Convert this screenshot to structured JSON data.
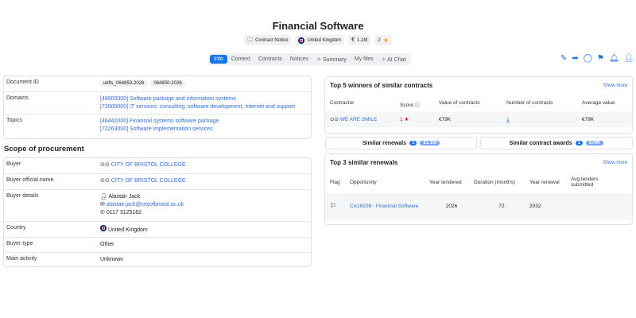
{
  "page": {
    "title": "Financial Software"
  },
  "meta": {
    "notice_type": "Contract Notice",
    "country": "United Kingdom",
    "value": "1.1M",
    "rating": "2"
  },
  "tabs": [
    "Info",
    "Context",
    "Contracts",
    "Notices",
    "Summary",
    "My files",
    "AI Chat"
  ],
  "details": {
    "document_id_label": "Document ID",
    "document_ids": [
      "ukfts_064850-2026",
      "064850-2026"
    ],
    "domains_label": "Domains",
    "domains": [
      "[48000000] Software package and information systems",
      "[72000000] IT services: consulting, software development, Internet and support"
    ],
    "topics_label": "Topics",
    "topics": [
      "[48442000] Financial systems software package",
      "[72263000] Software implementation services"
    ]
  },
  "scope": {
    "heading": "Scope of procurement",
    "buyer_label": "Buyer",
    "buyer": "CITY OF BRISTOL COLLEGE",
    "buyer_official_label": "Buyer official name",
    "buyer_official": "CITY OF BRISTOL COLLEGE",
    "buyer_details_label": "Buyer details",
    "contact_name": "Alastair Jack",
    "contact_email": "alastair.jack@cityofbristol.ac.uk",
    "contact_phone": "0117 3125182",
    "country_label": "Country",
    "country": "United Kingdom",
    "buyer_type_label": "Buyer type",
    "buyer_type": "Other",
    "main_activity_label": "Main activity",
    "main_activity": "Unknown"
  },
  "winners": {
    "heading": "Top 5 winners of similar contracts",
    "show_more": "Show more",
    "columns": [
      "Contractor",
      "Score",
      "Value of contracts",
      "Number of contracts",
      "Average value"
    ],
    "row": {
      "contractor": "WE ARE SMILE",
      "score": "1",
      "value": "€79K",
      "count": "1",
      "average": "€79K"
    }
  },
  "similar": {
    "renewals_label": "Similar renewals",
    "renewals_count": "1",
    "renewals_value": "€1.1M",
    "awards_label": "Similar contract awards",
    "awards_count": "1",
    "awards_value": "€79K"
  },
  "renewals": {
    "heading": "Top 3 similar renewals",
    "show_more": "Show more",
    "columns": [
      "Flag",
      "Opportunity",
      "Year tendered",
      "Duration (months)",
      "Year renewal",
      "Avg tenders submitted"
    ],
    "row": {
      "opportunity": "CA18208 - Financial Software",
      "year_tendered": "2026",
      "duration": "72",
      "year_renewal": "2032",
      "avg_tenders": ""
    }
  }
}
